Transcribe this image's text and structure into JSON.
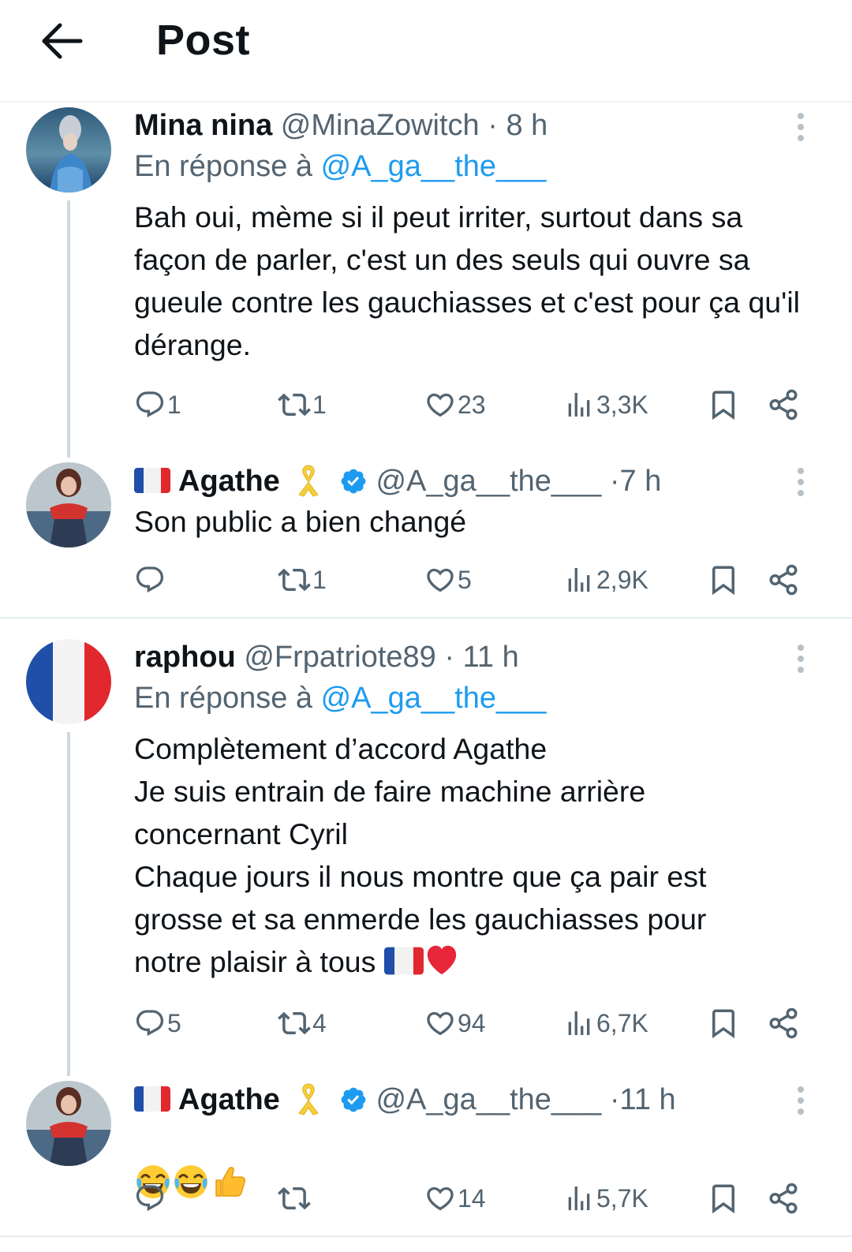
{
  "header": {
    "title": "Post"
  },
  "colors": {
    "link": "#1d9bf0",
    "secondary": "#536471",
    "verified": "#1d9bf0",
    "heart": "#e8263a"
  },
  "tweets": [
    {
      "name": "Mina nina",
      "handle": "@MinaZowitch",
      "dot": "·",
      "time": "8 h",
      "reply_prefix": "En réponse à ",
      "reply_to": "@A_ga__the___",
      "text": "Bah oui, mème si il peut irriter, surtout dans sa façon de parler, c'est un des seuls qui ouvre sa gueule contre les gauchiasses et c'est pour ça qu'il dérange.",
      "replies": "1",
      "retweets": "1",
      "likes": "23",
      "views": "3,3K"
    },
    {
      "name": "Agathe",
      "handle": "@A_ga__the___",
      "dot": "·",
      "time": "7 h",
      "text": "Son public a bien changé",
      "replies": "",
      "retweets": "1",
      "likes": "5",
      "views": "2,9K"
    },
    {
      "name": "raphou",
      "handle": "@Frpatriote89",
      "dot": "·",
      "time": "11 h",
      "reply_prefix": "En réponse à ",
      "reply_to": "@A_ga__the___",
      "text_lines": [
        "Complètement d’accord Agathe",
        "Je suis entrain de faire machine arrière",
        "concernant Cyril",
        "Chaque jours il nous montre que ça pair est",
        "grosse et sa enmerde les gauchiasses pour",
        "notre plaisir à tous"
      ],
      "replies": "5",
      "retweets": "4",
      "likes": "94",
      "views": "6,7K"
    },
    {
      "name": "Agathe",
      "handle": "@A_ga__the___",
      "dot": "·",
      "time": "11 h",
      "text": "",
      "replies": "",
      "retweets": "",
      "likes": "14",
      "views": "5,7K"
    }
  ]
}
